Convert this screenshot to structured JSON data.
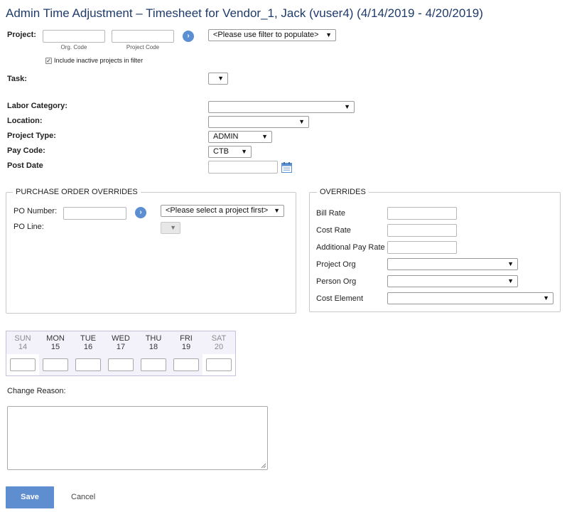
{
  "page": {
    "title": "Admin Time Adjustment – Timesheet for Vendor_1, Jack (vuser4) (4/14/2019 - 4/20/2019)"
  },
  "project": {
    "label": "Project:",
    "org_code_caption": "Org. Code",
    "project_code_caption": "Project Code",
    "filter_select": "<Please use filter to populate>",
    "include_inactive_label": "Include inactive projects in filter",
    "include_inactive_checked": true
  },
  "task": {
    "label": "Task:",
    "value": ""
  },
  "fields": {
    "labor_category": {
      "label": "Labor Category:",
      "value": ""
    },
    "location": {
      "label": "Location:",
      "value": ""
    },
    "project_type": {
      "label": "Project Type:",
      "value": "ADMIN"
    },
    "pay_code": {
      "label": "Pay Code:",
      "value": "CTB"
    },
    "post_date": {
      "label": "Post Date",
      "value": ""
    }
  },
  "po_overrides": {
    "legend": "PURCHASE ORDER OVERRIDES",
    "po_number_label": "PO Number:",
    "po_select": "<Please select a project first>",
    "po_line_label": "PO Line:"
  },
  "overrides": {
    "legend": "OVERRIDES",
    "bill_rate": "Bill Rate",
    "cost_rate": "Cost Rate",
    "additional_pay_rate": "Additional Pay Rate",
    "project_org": "Project Org",
    "person_org": "Person Org",
    "cost_element": "Cost Element"
  },
  "week": {
    "days": [
      {
        "name": "SUN",
        "num": "14",
        "weekend": true
      },
      {
        "name": "MON",
        "num": "15",
        "weekend": false
      },
      {
        "name": "TUE",
        "num": "16",
        "weekend": false
      },
      {
        "name": "WED",
        "num": "17",
        "weekend": false
      },
      {
        "name": "THU",
        "num": "18",
        "weekend": false
      },
      {
        "name": "FRI",
        "num": "19",
        "weekend": false
      },
      {
        "name": "SAT",
        "num": "20",
        "weekend": true
      }
    ]
  },
  "change_reason": {
    "label": "Change Reason:",
    "value": ""
  },
  "actions": {
    "save": "Save",
    "cancel": "Cancel"
  },
  "colors": {
    "accent": "#5f8ed0",
    "title": "#1f3b6b",
    "weekgrid": "#f3f2fb"
  }
}
